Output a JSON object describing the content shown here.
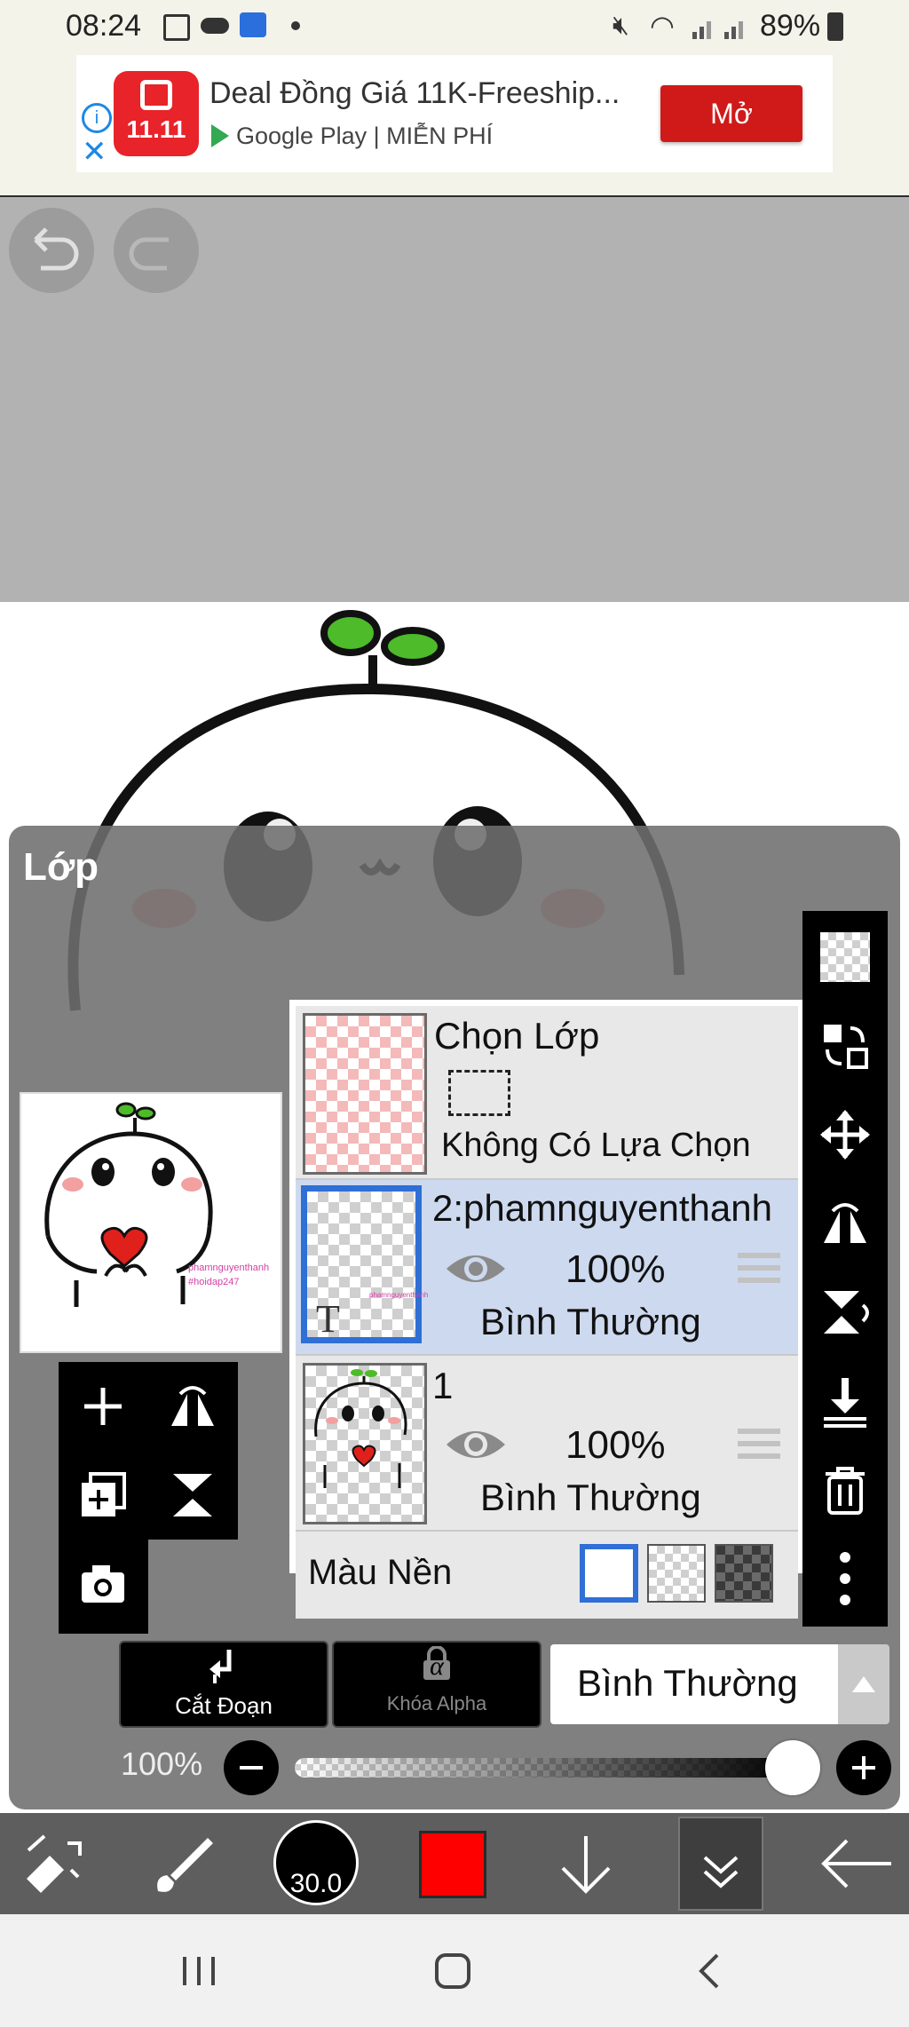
{
  "status_bar": {
    "time": "08:24",
    "battery": "89%"
  },
  "ad": {
    "title": "Deal Đồng Giá 11K-Freeship...",
    "subtitle": "Google Play | MIỄN PHÍ",
    "app_badge": "11.11",
    "open_button": "Mở"
  },
  "layers_panel": {
    "title": "Lớp",
    "selection_layer": {
      "name": "Chọn Lớp",
      "status": "Không Có Lựa Chọn"
    },
    "layers": [
      {
        "name": "2:phamnguyenthanh",
        "opacity": "100%",
        "blend": "Bình Thường",
        "type_glyph": "T",
        "selected": true
      },
      {
        "name": "1",
        "opacity": "100%",
        "blend": "Bình Thường",
        "selected": false
      }
    ],
    "background": {
      "label": "Màu Nền"
    },
    "clipping_button": "Cắt Đoạn",
    "alpha_lock_button": "Khóa Alpha",
    "alpha_glyph": "α",
    "blend_mode": "Bình Thường",
    "opacity_value": "100%",
    "preview_watermark": [
      "phamnguyenthanh",
      "#hoidap247"
    ]
  },
  "bottom_toolbar": {
    "brush_size": "30.0",
    "current_color": "#ff0000"
  },
  "colors": {
    "selected_layer_bg": "#cdd9ee",
    "selected_border": "#2f6fd6",
    "panel_bg": "#7a7a7a",
    "toolbar_bg": "#5e5e5e",
    "ad_button": "#d01a1a"
  }
}
